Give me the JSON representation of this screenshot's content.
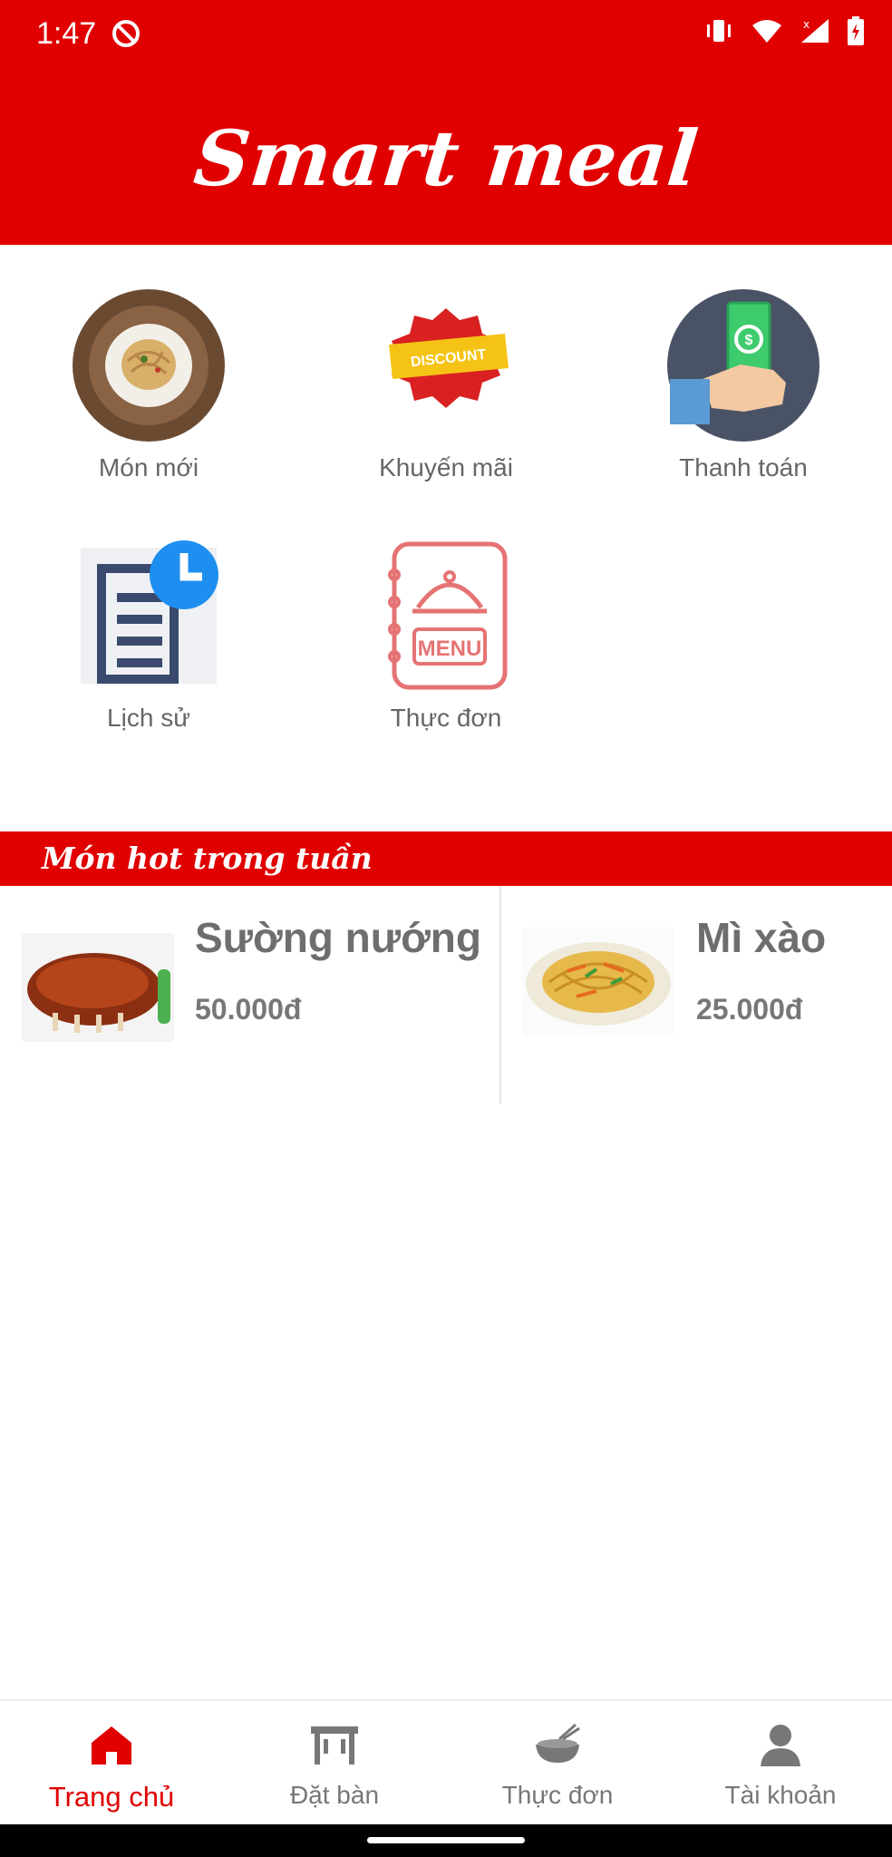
{
  "status_bar": {
    "time": "1:47"
  },
  "header": {
    "title": "Smart meal"
  },
  "grid": [
    {
      "label": "Món mới",
      "icon": "noodle-plate-icon"
    },
    {
      "label": "Khuyến mãi",
      "icon": "discount-badge-icon"
    },
    {
      "label": "Thanh toán",
      "icon": "cash-payment-icon"
    },
    {
      "label": "Lịch sử",
      "icon": "history-document-icon"
    },
    {
      "label": "Thực đơn",
      "icon": "menu-book-icon"
    }
  ],
  "hot_section": {
    "title": "Món hot trong tuần",
    "items": [
      {
        "name": "Sường nướng",
        "price": "50.000đ"
      },
      {
        "name": "Mì xào",
        "price": "25.000đ"
      }
    ]
  },
  "bottom_nav": [
    {
      "label": "Trang chủ",
      "icon": "home-icon",
      "active": true
    },
    {
      "label": "Đặt bàn",
      "icon": "table-icon",
      "active": false
    },
    {
      "label": "Thực đơn",
      "icon": "food-bowl-icon",
      "active": false
    },
    {
      "label": "Tài khoản",
      "icon": "account-icon",
      "active": false
    }
  ],
  "colors": {
    "primary": "#e00000",
    "text_gray": "#666666",
    "nav_inactive": "#777777"
  }
}
